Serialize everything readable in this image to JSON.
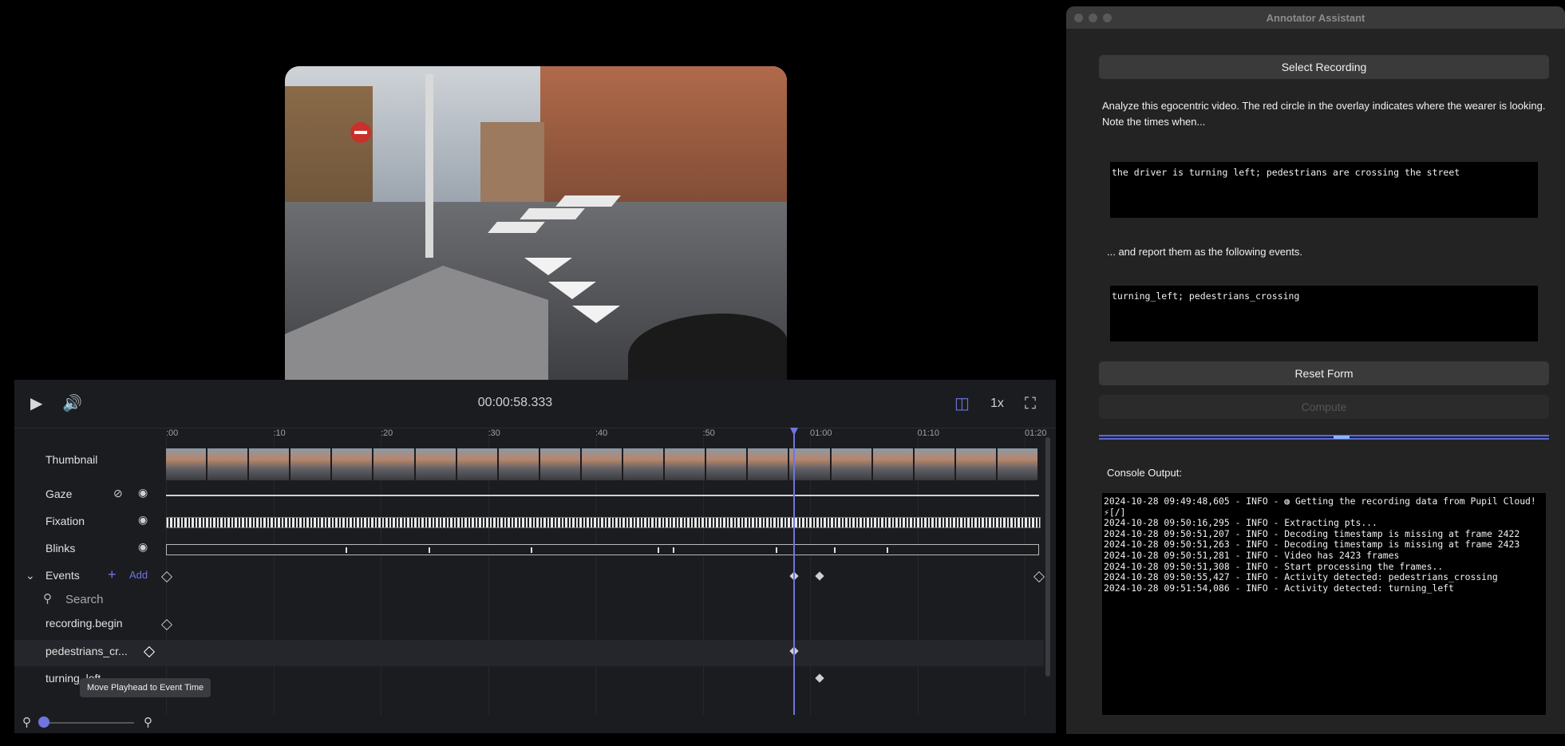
{
  "player": {
    "time": "00:00:58.333",
    "speed": "1x",
    "ticks": [
      ":00",
      ":10",
      ":20",
      ":30",
      ":40",
      ":50",
      "01:00",
      "01:10",
      "01:20"
    ],
    "rows": {
      "thumbnail": "Thumbnail",
      "gaze": "Gaze",
      "fixation": "Fixation",
      "blinks": "Blinks",
      "events": "Events",
      "add": "Add",
      "search_placeholder": "Search",
      "event_items": [
        "recording.begin",
        "pedestrians_cr...",
        "turning_left"
      ]
    },
    "tooltip": "Move Playhead to Event Time",
    "accent": "#6f74e0"
  },
  "assistant": {
    "title": "Annotator Assistant",
    "select_button": "Select Recording",
    "instruction": "Analyze this egocentric video. The red circle in the overlay indicates where the wearer is looking. Note the times when...",
    "query": "the driver is turning left; pedestrians are crossing the street",
    "report_label": "... and report them as the following events.",
    "events": "turning_left; pedestrians_crossing",
    "reset_button": "Reset Form",
    "compute_button": "Compute",
    "console_label": "Console Output:",
    "console_lines": [
      "2024-10-28 09:49:48,605 - INFO - ◍ Getting the recording data from Pupil Cloud! ⚡[/]",
      "2024-10-28 09:50:16,295 - INFO - Extracting pts...",
      "2024-10-28 09:50:51,207 - INFO - Decoding timestamp is missing at frame 2422",
      "2024-10-28 09:50:51,263 - INFO - Decoding timestamp is missing at frame 2423",
      "2024-10-28 09:50:51,281 - INFO - Video has 2423 frames",
      "2024-10-28 09:50:51,308 - INFO - Start processing the frames..",
      "2024-10-28 09:50:55,427 - INFO - Activity detected: pedestrians_crossing",
      "2024-10-28 09:51:54,086 - INFO - Activity detected: turning_left"
    ]
  }
}
